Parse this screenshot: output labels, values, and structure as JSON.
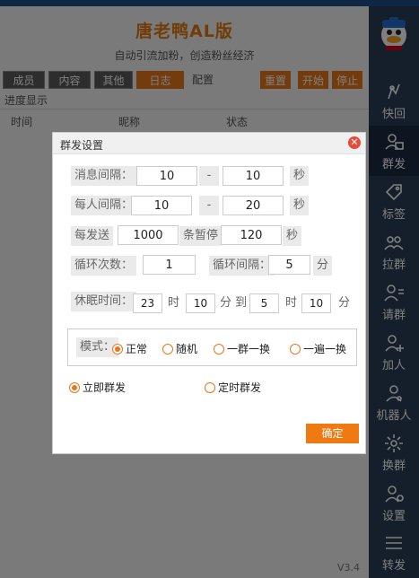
{
  "app": {
    "title": "唐老鸭AL版",
    "subtitle": "自动引流加粉，创造粉丝经济",
    "tabs": [
      "成员",
      "内容",
      "其他",
      "日志",
      "配置"
    ],
    "actions": [
      "重置",
      "开始",
      "停止"
    ],
    "progress_label": "进度显示",
    "columns": [
      "时间",
      "昵称",
      "状态"
    ],
    "version": "V3.4"
  },
  "sidebar": {
    "items": [
      {
        "label": "快回",
        "icon": "quick-reply-icon"
      },
      {
        "label": "群发",
        "icon": "mass-send-icon"
      },
      {
        "label": "标签",
        "icon": "tag-icon"
      },
      {
        "label": "拉群",
        "icon": "pull-group-icon"
      },
      {
        "label": "请群",
        "icon": "invite-group-icon"
      },
      {
        "label": "加人",
        "icon": "add-person-icon"
      },
      {
        "label": "机器人",
        "icon": "robot-icon"
      },
      {
        "label": "换群",
        "icon": "switch-group-icon"
      },
      {
        "label": "设置",
        "icon": "settings-icon"
      },
      {
        "label": "转发",
        "icon": "forward-icon"
      }
    ],
    "active_index": 1
  },
  "dialog": {
    "title": "群发设置",
    "msg_interval": {
      "label": "消息间隔：",
      "from": "10",
      "sep": "-",
      "to": "10",
      "unit": "秒"
    },
    "person_interval": {
      "label": "每人间隔：",
      "from": "10",
      "sep": "-",
      "to": "20",
      "unit": "秒"
    },
    "pause": {
      "label": "每发送",
      "count": "1000",
      "mid": "条暂停",
      "seconds": "120",
      "unit": "秒"
    },
    "loop": {
      "count_label": "循环次数：",
      "count": "1",
      "interval_label": "循环间隔：",
      "interval": "5",
      "unit": "分"
    },
    "sleep": {
      "label": "休眠时间：",
      "h1": "23",
      "t1": "时",
      "m1": "10",
      "t2": "分 到",
      "h2": "5",
      "t3": "时",
      "m2": "10",
      "t4": "分"
    },
    "mode": {
      "label": "模式：",
      "options": [
        "正常",
        "随机",
        "一群一换",
        "一遍一换"
      ],
      "selected": 0
    },
    "send_type": {
      "options": [
        "立即群发",
        "定时群发"
      ],
      "selected": 0
    },
    "ok_label": "确定"
  },
  "colors": {
    "accent": "#f07a12",
    "sidebar": "#2b3d57",
    "topbar": "#1f4e8c"
  }
}
